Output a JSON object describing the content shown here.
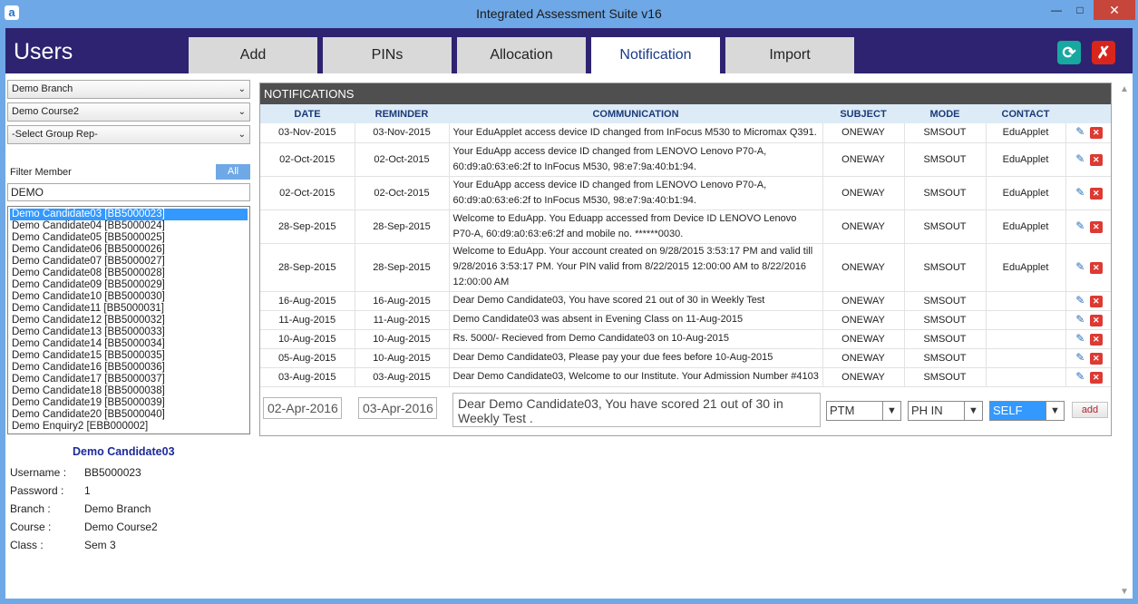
{
  "window": {
    "app_icon_letter": "a",
    "title": "Integrated Assessment Suite v16",
    "minimize": "—",
    "maximize": "□",
    "close": "✕"
  },
  "header": {
    "page_title": "Users",
    "tabs": [
      {
        "label": "Add"
      },
      {
        "label": "PINs"
      },
      {
        "label": "Allocation"
      },
      {
        "label": "Notification",
        "active": true
      },
      {
        "label": "Import"
      }
    ],
    "refresh_icon": "refresh-icon",
    "close_icon": "close-icon",
    "refresh_glyph": "⟳",
    "close_glyph": "✗"
  },
  "filters": {
    "branch": "Demo Branch",
    "course": "Demo Course2",
    "group_rep": "-Select Group Rep-",
    "filter_label": "Filter Member",
    "all_button": "All",
    "filter_value": "DEMO"
  },
  "members": [
    "Demo Candidate03 [BB5000023]",
    "Demo Candidate04 [BB5000024]",
    "Demo Candidate05 [BB5000025]",
    "Demo Candidate06 [BB5000026]",
    "Demo Candidate07 [BB5000027]",
    "Demo Candidate08 [BB5000028]",
    "Demo Candidate09 [BB5000029]",
    "Demo Candidate10 [BB5000030]",
    "Demo Candidate11 [BB5000031]",
    "Demo Candidate12 [BB5000032]",
    "Demo Candidate13 [BB5000033]",
    "Demo Candidate14 [BB5000034]",
    "Demo Candidate15 [BB5000035]",
    "Demo Candidate16 [BB5000036]",
    "Demo Candidate17 [BB5000037]",
    "Demo Candidate18 [BB5000038]",
    "Demo Candidate19 [BB5000039]",
    "Demo Candidate20 [BB5000040]",
    "Demo Enquiry2 [EBB000002]"
  ],
  "selected_member": {
    "name": "Demo Candidate03",
    "fields": [
      {
        "label": "Username :",
        "value": "BB5000023"
      },
      {
        "label": "Password :",
        "value": "1"
      },
      {
        "label": "Branch :",
        "value": "Demo Branch"
      },
      {
        "label": "Course :",
        "value": "Demo Course2"
      },
      {
        "label": "Class :",
        "value": "Sem 3"
      }
    ]
  },
  "notifications": {
    "title": "NOTIFICATIONS",
    "columns": [
      "DATE",
      "REMINDER",
      "COMMUNICATION",
      "SUBJECT",
      "MODE",
      "CONTACT"
    ],
    "rows": [
      {
        "date": "03-Nov-2015",
        "reminder": "03-Nov-2015",
        "communication": "Your EduApplet access device ID changed from InFocus M530 to Micromax Q391.",
        "subject": "ONEWAY",
        "mode": "SMSOUT",
        "contact": "EduApplet"
      },
      {
        "date": "02-Oct-2015",
        "reminder": "02-Oct-2015",
        "communication": "Your EduApp access device ID changed from LENOVO Lenovo P70-A, 60:d9:a0:63:e6:2f to InFocus M530, 98:e7:9a:40:b1:94.",
        "subject": "ONEWAY",
        "mode": "SMSOUT",
        "contact": "EduApplet"
      },
      {
        "date": "02-Oct-2015",
        "reminder": "02-Oct-2015",
        "communication": "Your EduApp access device ID changed from LENOVO Lenovo P70-A, 60:d9:a0:63:e6:2f to InFocus M530, 98:e7:9a:40:b1:94.",
        "subject": "ONEWAY",
        "mode": "SMSOUT",
        "contact": "EduApplet"
      },
      {
        "date": "28-Sep-2015",
        "reminder": "28-Sep-2015",
        "communication": "Welcome to EduApp. You Eduapp accessed from Device ID LENOVO Lenovo P70-A, 60:d9:a0:63:e6:2f and mobile no. ******0030.",
        "subject": "ONEWAY",
        "mode": "SMSOUT",
        "contact": "EduApplet"
      },
      {
        "date": "28-Sep-2015",
        "reminder": "28-Sep-2015",
        "communication": "Welcome to EduApp. Your account created on 9/28/2015 3:53:17 PM and valid till 9/28/2016 3:53:17 PM. Your PIN valid from 8/22/2015 12:00:00 AM to 8/22/2016 12:00:00 AM",
        "subject": "ONEWAY",
        "mode": "SMSOUT",
        "contact": "EduApplet"
      },
      {
        "date": "16-Aug-2015",
        "reminder": "16-Aug-2015",
        "communication": "Dear Demo Candidate03, You have scored 21 out of 30 in Weekly Test",
        "subject": "ONEWAY",
        "mode": "SMSOUT",
        "contact": ""
      },
      {
        "date": "11-Aug-2015",
        "reminder": "11-Aug-2015",
        "communication": "Demo Candidate03 was absent in Evening Class on 11-Aug-2015",
        "subject": "ONEWAY",
        "mode": "SMSOUT",
        "contact": ""
      },
      {
        "date": "10-Aug-2015",
        "reminder": "10-Aug-2015",
        "communication": "Rs. 5000/- Recieved from Demo Candidate03 on 10-Aug-2015",
        "subject": "ONEWAY",
        "mode": "SMSOUT",
        "contact": ""
      },
      {
        "date": "05-Aug-2015",
        "reminder": "10-Aug-2015",
        "communication": "Dear Demo Candidate03, Please pay your due fees before 10-Aug-2015",
        "subject": "ONEWAY",
        "mode": "SMSOUT",
        "contact": ""
      },
      {
        "date": "03-Aug-2015",
        "reminder": "03-Aug-2015",
        "communication": "Dear Demo Candidate03, Welcome to our Institute. Your Admission Number #4103",
        "subject": "ONEWAY",
        "mode": "SMSOUT",
        "contact": ""
      }
    ],
    "new_entry": {
      "date": "02-Apr-2016",
      "reminder": "03-Apr-2016",
      "message": "Dear Demo Candidate03, You have scored 21 out of 30 in Weekly Test .",
      "subject": "PTM",
      "mode": "PH IN",
      "contact": "SELF",
      "add_label": "add"
    }
  },
  "colors": {
    "header_bg": "#2d2370",
    "titlebar_bg": "#6fa8e6",
    "accent": "#3399ff",
    "delete_red": "#dc3a32"
  }
}
